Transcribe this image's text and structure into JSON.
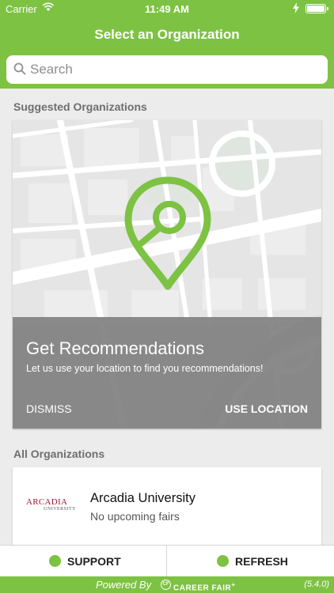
{
  "status_bar": {
    "carrier": "Carrier",
    "time": "11:49 AM"
  },
  "header": {
    "title": "Select an Organization"
  },
  "search": {
    "placeholder": "Search",
    "value": ""
  },
  "suggested": {
    "label": "Suggested Organizations",
    "card": {
      "title": "Get Recommendations",
      "subtitle": "Let us use your location to find you recommendations!",
      "dismiss_label": "DISMISS",
      "use_location_label": "USE LOCATION"
    }
  },
  "all_orgs": {
    "label": "All Organizations",
    "items": [
      {
        "logo_text": "ARCADIA",
        "logo_subtext": "UNIVERSITY",
        "name": "Arcadia University",
        "status": "No upcoming fairs"
      }
    ]
  },
  "bottom_bar": {
    "support_label": "SUPPORT",
    "refresh_label": "REFRESH"
  },
  "footer": {
    "powered_by": "Powered By",
    "brand": "CAREER FAIR",
    "brand_mark": "+",
    "version": "(5.4.0)"
  },
  "colors": {
    "accent": "#7dc243",
    "overlay": "#7d7d7d",
    "map_bg": "#e5e5e5",
    "logo_red": "#9b1b30"
  },
  "icons": [
    "wifi-icon",
    "charging-icon",
    "battery-icon",
    "search-icon",
    "location-pin-icon",
    "support-dot-icon",
    "refresh-dot-icon",
    "career-fair-logo-icon"
  ]
}
